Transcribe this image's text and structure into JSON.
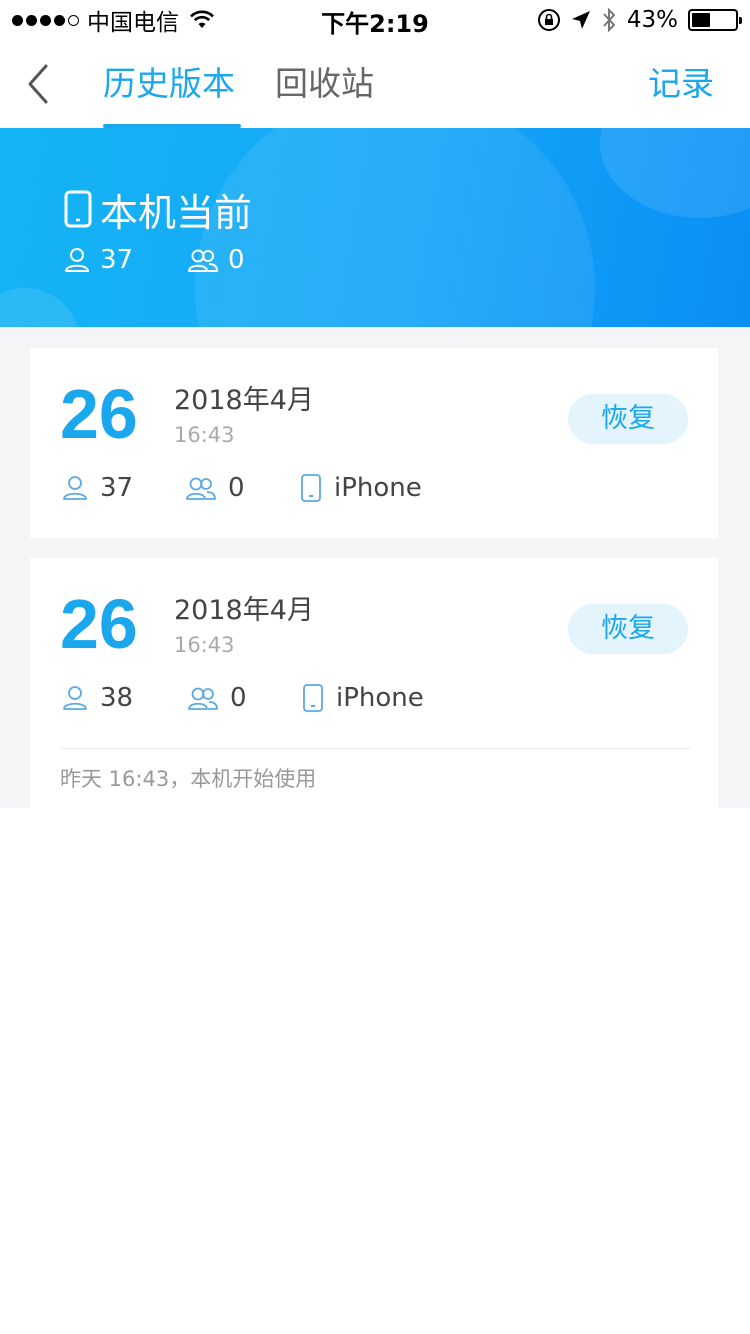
{
  "status_bar": {
    "carrier": "中国电信",
    "time": "下午2:19",
    "battery": "43%",
    "battery_level": 0.43
  },
  "nav": {
    "tabs": [
      {
        "label": "历史版本",
        "active": true
      },
      {
        "label": "回收站",
        "active": false
      }
    ],
    "record_label": "记录",
    "accent": "#1ba7ee"
  },
  "banner": {
    "title": "本机当前",
    "contacts": "37",
    "groups": "0"
  },
  "versions": [
    {
      "day": "26",
      "year_month": "2018年4月",
      "time": "16:43",
      "contacts": "37",
      "groups": "0",
      "device": "iPhone",
      "restore_label": "恢复"
    },
    {
      "day": "26",
      "year_month": "2018年4月",
      "time": "16:43",
      "contacts": "38",
      "groups": "0",
      "device": "iPhone",
      "restore_label": "恢复",
      "note": "昨天 16:43，本机开始使用"
    }
  ]
}
